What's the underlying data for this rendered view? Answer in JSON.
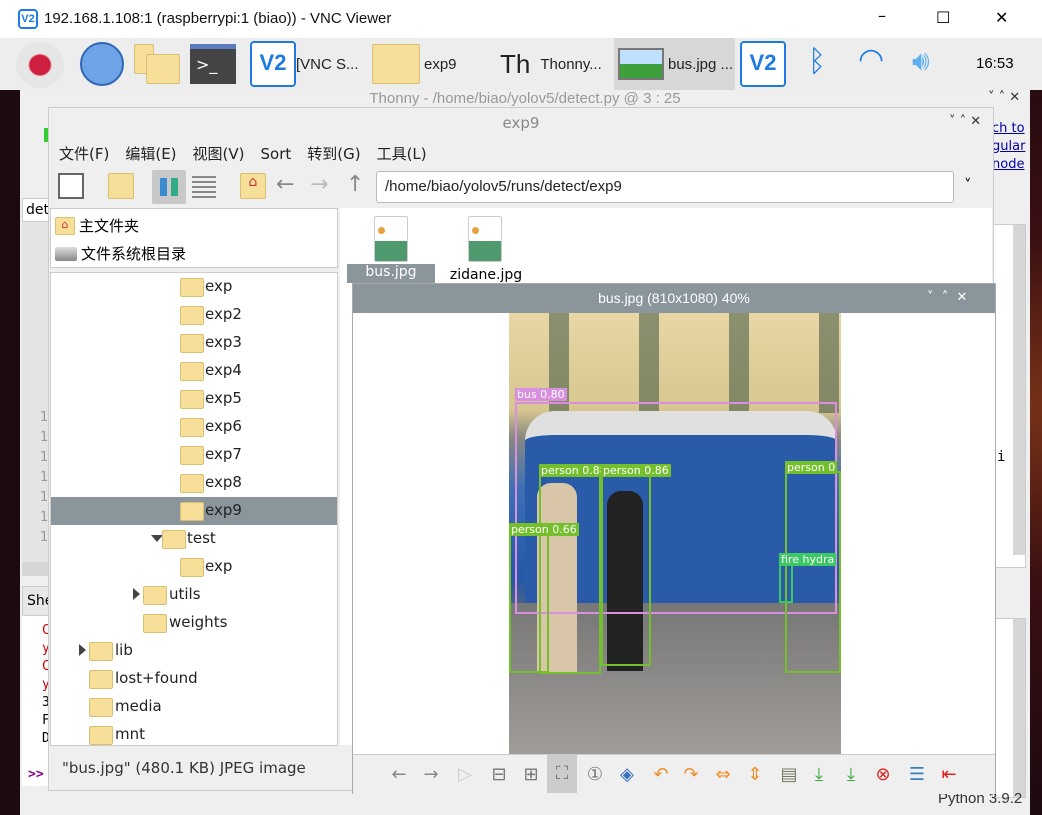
{
  "vnc": {
    "title": "192.168.1.108:1 (raspberrypi:1 (biao)) - VNC Viewer",
    "minimize": "–",
    "maximize": "☐",
    "close": "✕"
  },
  "taskbar": {
    "items": [
      {
        "label": "[VNC S..."
      },
      {
        "label": "exp9"
      },
      {
        "label": "Thonny..."
      },
      {
        "label": "bus.jpg ..."
      }
    ],
    "clock": "16:53"
  },
  "thonny": {
    "title": "Thonny  -  /home/biao/yolov5/detect.py  @  3 : 25",
    "tab": "det",
    "shell_tab": "She",
    "link_lines": [
      "ch to",
      "gular",
      "node"
    ],
    "line_nums": [
      "1",
      "1",
      "1",
      "1",
      "1",
      "1",
      "1"
    ],
    "shell_lines": [
      "C",
      "y",
      "C",
      "y",
      "3",
      "F",
      "D"
    ],
    "prompt": ">>",
    "editor_char": "i",
    "python_version": "Python 3.9.2"
  },
  "filemanager": {
    "title": "exp9",
    "menu": [
      "文件(F)",
      "编辑(E)",
      "视图(V)",
      "Sort",
      "转到(G)",
      "工具(L)"
    ],
    "path": "/home/biao/yolov5/runs/detect/exp9",
    "places": [
      "主文件夹",
      "文件系统根目录"
    ],
    "tree": [
      {
        "label": "exp",
        "level": 4
      },
      {
        "label": "exp2",
        "level": 4
      },
      {
        "label": "exp3",
        "level": 4
      },
      {
        "label": "exp4",
        "level": 4
      },
      {
        "label": "exp5",
        "level": 4
      },
      {
        "label": "exp6",
        "level": 4
      },
      {
        "label": "exp7",
        "level": 4
      },
      {
        "label": "exp8",
        "level": 4
      },
      {
        "label": "exp9",
        "level": 4,
        "selected": true
      },
      {
        "label": "test",
        "level": 3,
        "expanded": true
      },
      {
        "label": "exp",
        "level": 4
      },
      {
        "label": "utils",
        "level": 2,
        "collapsed": true
      },
      {
        "label": "weights",
        "level": 2
      },
      {
        "label": "lib",
        "level": 0,
        "collapsed": true
      },
      {
        "label": "lost+found",
        "level": 0
      },
      {
        "label": "media",
        "level": 0
      },
      {
        "label": "mnt",
        "level": 0
      }
    ],
    "files": [
      "bus.jpg",
      "zidane.jpg"
    ],
    "status": "\"bus.jpg\" (480.1 KB) JPEG image"
  },
  "viewer": {
    "title": "bus.jpg (810x1080) 40%",
    "detections": [
      {
        "label": "bus 0.80",
        "color": "#d88fe0"
      },
      {
        "label": "person 0.88",
        "color": "#74c02c"
      },
      {
        "label": "person 0.86",
        "color": "#74c02c"
      },
      {
        "label": "person 0",
        "color": "#74c02c"
      },
      {
        "label": "person 0.66",
        "color": "#74c02c"
      },
      {
        "label": "fire hydra",
        "color": "#3cc864"
      }
    ]
  },
  "colors": {
    "selection": "#8a959c",
    "accent": "#1e7be0"
  }
}
